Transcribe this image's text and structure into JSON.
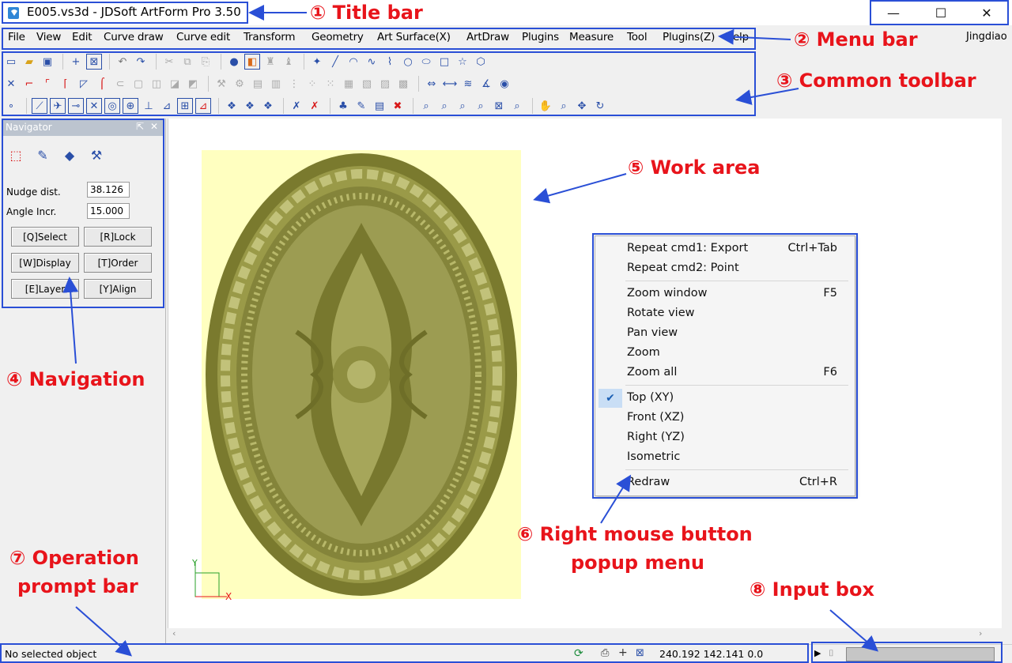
{
  "window": {
    "title": "E005.vs3d - JDSoft ArtForm Pro 3.50",
    "minimize_glyph": "—",
    "maximize_glyph": "☐",
    "close_glyph": "✕"
  },
  "menu": {
    "items": [
      "File",
      "View",
      "Edit",
      "Curve draw",
      "Curve edit",
      "Transform",
      "Geometry",
      "Art Surface(X)",
      "ArtDraw",
      "Plugins",
      "Measure",
      "Tool",
      "Plugins(Z)",
      "Help"
    ],
    "right_label": "Jingdiao"
  },
  "navigator": {
    "title": "Navigator",
    "nudge_label": "Nudge dist.",
    "nudge_value": "38.126",
    "angle_label": "Angle Incr.",
    "angle_value": "15.000",
    "buttons": [
      "[Q]Select",
      "[R]Lock",
      "[W]Display",
      "[T]Order",
      "[E]Layer",
      "[Y]Align"
    ]
  },
  "context_menu": {
    "items": [
      {
        "label": "Repeat cmd1: Export",
        "shortcut": "Ctrl+Tab"
      },
      {
        "label": "Repeat cmd2: Point",
        "shortcut": ""
      },
      {
        "label": "Zoom window",
        "shortcut": "F5"
      },
      {
        "label": "Rotate view",
        "shortcut": ""
      },
      {
        "label": "Pan view",
        "shortcut": ""
      },
      {
        "label": "Zoom",
        "shortcut": ""
      },
      {
        "label": "Zoom all",
        "shortcut": "F6"
      },
      {
        "label": "Top (XY)",
        "shortcut": "",
        "checked": true
      },
      {
        "label": "Front (XZ)",
        "shortcut": ""
      },
      {
        "label": "Right (YZ)",
        "shortcut": ""
      },
      {
        "label": "Isometric",
        "shortcut": ""
      },
      {
        "label": "Redraw",
        "shortcut": "Ctrl+R"
      }
    ]
  },
  "status": {
    "prompt": "No selected object",
    "coords": "240.192 142.141 0.0"
  },
  "axis": {
    "x": "X",
    "y": "Y"
  },
  "annotations": {
    "title_bar": "① Title bar",
    "menu_bar": "② Menu bar",
    "common_toolbar": "③ Common toolbar",
    "navigation": "④ Navigation",
    "work_area": "⑤ Work area",
    "popup_line1": "⑥ Right mouse button",
    "popup_line2": "popup menu",
    "prompt_line1": "⑦ Operation",
    "prompt_line2": "prompt bar",
    "input_box": "⑧ Input box"
  },
  "colors": {
    "annotation_text": "#e8141b",
    "annotation_box": "#2a4fd6",
    "canvas_bg": "#ffffc0",
    "relief": "#8c8c3c"
  }
}
